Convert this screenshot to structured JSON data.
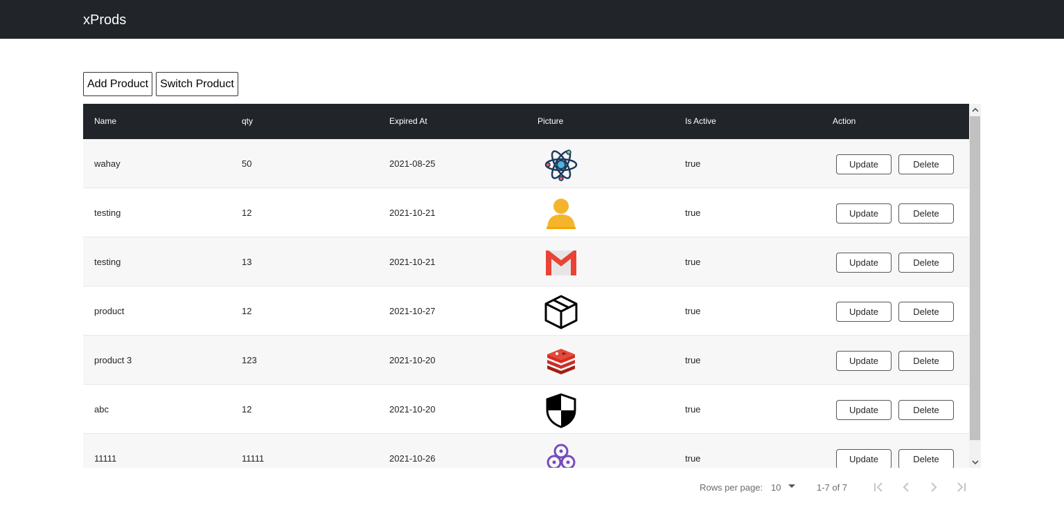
{
  "app": {
    "brand": "xProds"
  },
  "toolbar": {
    "add_label": "Add Product",
    "switch_label": "Switch Product"
  },
  "table": {
    "columns": [
      "Name",
      "qty",
      "Expired At",
      "Picture",
      "Is Active",
      "Action"
    ],
    "rows": [
      {
        "name": "wahay",
        "qty": "50",
        "expired": "2021-08-25",
        "picture": "atom-icon",
        "active": "true"
      },
      {
        "name": "testing",
        "qty": "12",
        "expired": "2021-10-21",
        "picture": "user-icon",
        "active": "true"
      },
      {
        "name": "testing",
        "qty": "13",
        "expired": "2021-10-21",
        "picture": "gmail-icon",
        "active": "true"
      },
      {
        "name": "product",
        "qty": "12",
        "expired": "2021-10-27",
        "picture": "box-icon",
        "active": "true"
      },
      {
        "name": "product 3",
        "qty": "123",
        "expired": "2021-10-20",
        "picture": "redis-icon",
        "active": "true"
      },
      {
        "name": "abc",
        "qty": "12",
        "expired": "2021-10-20",
        "picture": "shield-icon",
        "active": "true"
      },
      {
        "name": "11111",
        "qty": "11111",
        "expired": "2021-10-26",
        "picture": "redux-icon",
        "active": "true"
      }
    ],
    "update_label": "Update",
    "delete_label": "Delete"
  },
  "pagination": {
    "rows_per_page_label": "Rows per page:",
    "rows_per_page_value": "10",
    "range": "1-7 of 7"
  },
  "colors": {
    "header_bg": "#212529",
    "row_alt": "#f7f7f7"
  }
}
